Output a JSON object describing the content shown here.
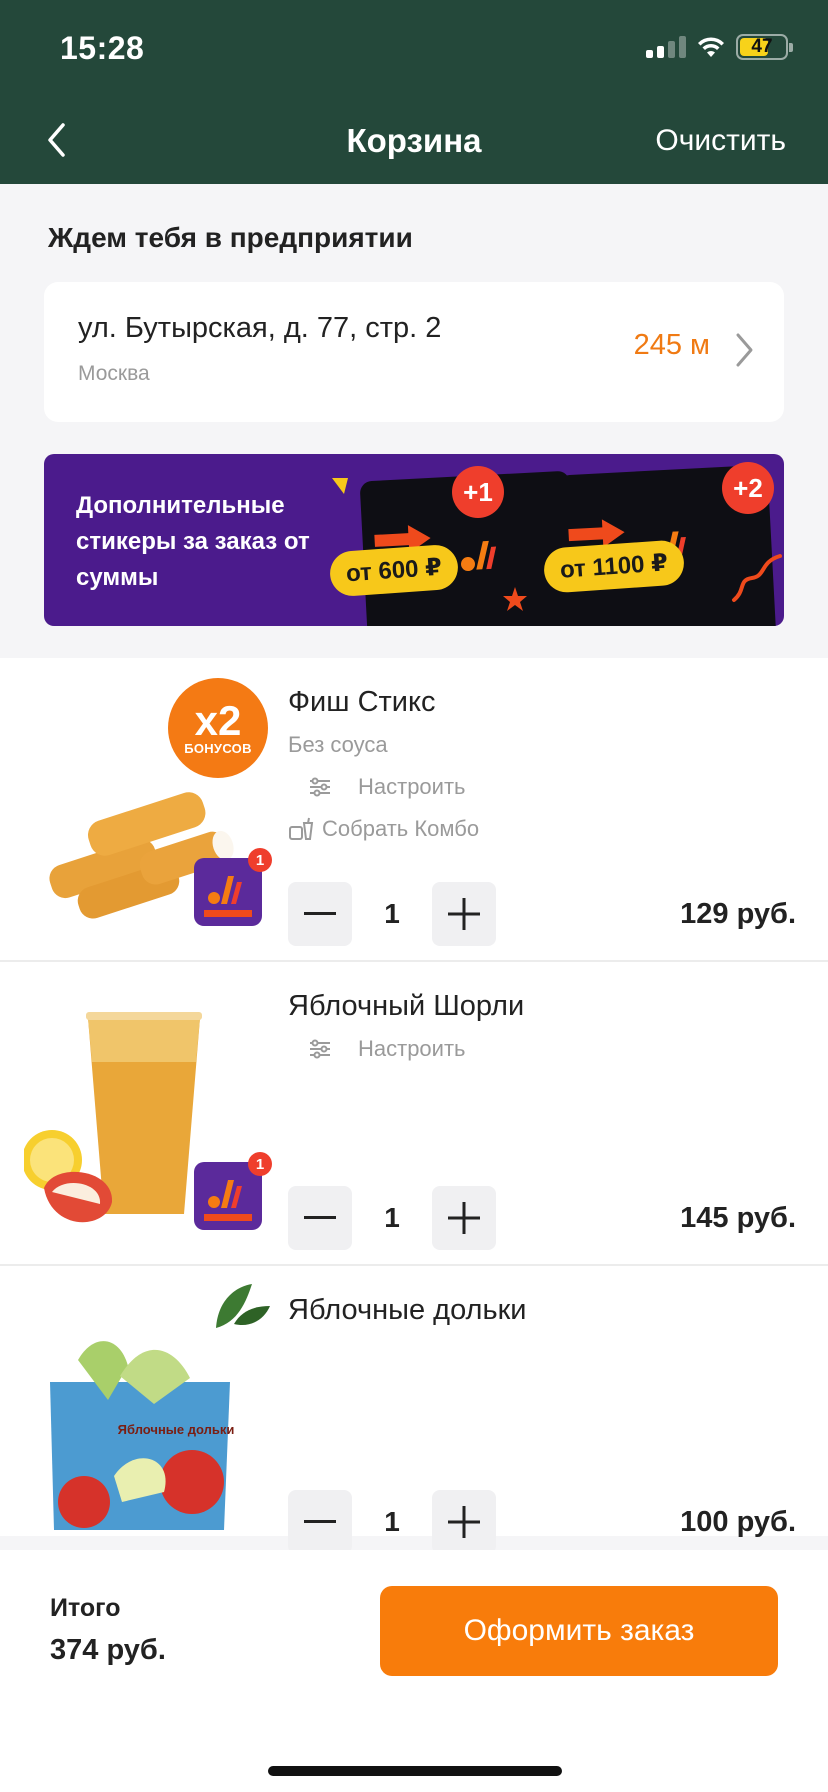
{
  "status": {
    "time": "15:28",
    "battery": "47"
  },
  "nav": {
    "title": "Корзина",
    "clear_label": "Очистить"
  },
  "pickup": {
    "title": "Ждем тебя в предприятии",
    "street": "ул. Бутырская, д. 77, стр. 2",
    "city": "Москва",
    "distance": "245 м"
  },
  "promo": {
    "text": "Дополнительные стикеры за заказ от суммы",
    "tiers": [
      {
        "plus": "+1",
        "threshold": "от 600 ₽"
      },
      {
        "plus": "+2",
        "threshold": "от 1100 ₽"
      }
    ]
  },
  "items": [
    {
      "name": "Фиш Стикс",
      "sauce": "Без соуса",
      "customize_label": "Настроить",
      "combo_label": "Собрать Комбо",
      "bonus_multiplier": "x2",
      "bonus_label": "БОНУСОВ",
      "sticker_count": "1",
      "qty": "1",
      "price": "129 руб."
    },
    {
      "name": "Яблочный Шорли",
      "customize_label": "Настроить",
      "sticker_count": "1",
      "qty": "1",
      "price": "145 руб."
    },
    {
      "name": "Яблочные дольки",
      "package_label": "Яблочные дольки",
      "qty": "1",
      "price": "100 руб."
    }
  ],
  "footer": {
    "total_label": "Итого",
    "total_value": "374 руб.",
    "checkout_label": "Оформить заказ"
  },
  "colors": {
    "header_bg": "#24483a",
    "accent_orange": "#f87c0b",
    "promo_bg": "#4b1b8c"
  }
}
